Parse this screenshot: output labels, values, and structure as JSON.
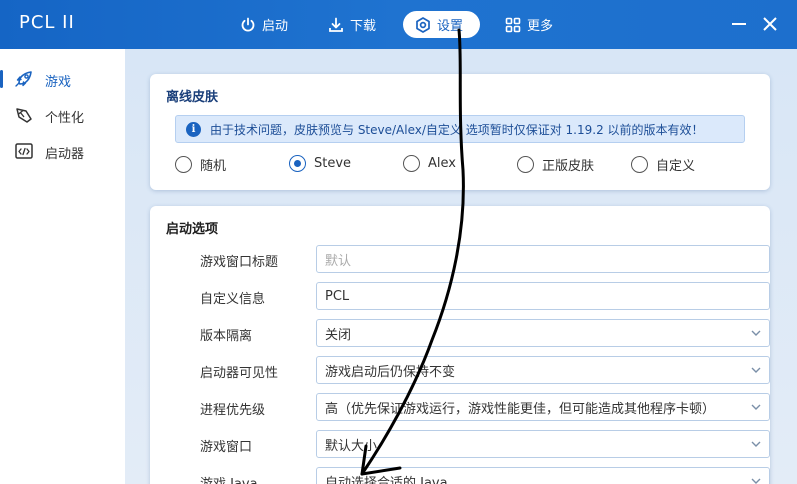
{
  "app": {
    "title": "PCL II"
  },
  "nav": {
    "launch": "启动",
    "download": "下载",
    "settings": "设置",
    "more": "更多"
  },
  "sidebar": {
    "items": [
      {
        "label": "游戏",
        "icon": "rocket-icon",
        "active": true
      },
      {
        "label": "个性化",
        "icon": "brush-icon",
        "active": false
      },
      {
        "label": "启动器",
        "icon": "code-window-icon",
        "active": false
      }
    ]
  },
  "skin_card": {
    "title": "离线皮肤",
    "hint": "由于技术问题，皮肤预览与 Steve/Alex/自定义 选项暂时仅保证对 1.19.2 以前的版本有效！",
    "options": [
      {
        "label": "随机",
        "checked": false
      },
      {
        "label": "Steve",
        "checked": true
      },
      {
        "label": "Alex",
        "checked": false
      },
      {
        "label": "正版皮肤",
        "checked": false
      },
      {
        "label": "自定义",
        "checked": false
      }
    ]
  },
  "launch_card": {
    "title": "启动选项",
    "rows": [
      {
        "label": "游戏窗口标题",
        "value": "默认",
        "placeholder": true,
        "dropdown": false
      },
      {
        "label": "自定义信息",
        "value": "PCL",
        "placeholder": false,
        "dropdown": false
      },
      {
        "label": "版本隔离",
        "value": "关闭",
        "placeholder": false,
        "dropdown": true
      },
      {
        "label": "启动器可见性",
        "value": "游戏启动后仍保持不变",
        "placeholder": false,
        "dropdown": true
      },
      {
        "label": "进程优先级",
        "value": "高（优先保证游戏运行，游戏性能更佳，但可能造成其他程序卡顿）",
        "placeholder": false,
        "dropdown": true
      },
      {
        "label": "游戏窗口",
        "value": "默认大小",
        "placeholder": false,
        "dropdown": true
      },
      {
        "label": "游戏 Java",
        "value": "自动选择合适的 Java",
        "placeholder": false,
        "dropdown": true
      }
    ]
  },
  "colors": {
    "accent": "#1a63c0",
    "titlebar": "#1d6fcd"
  }
}
